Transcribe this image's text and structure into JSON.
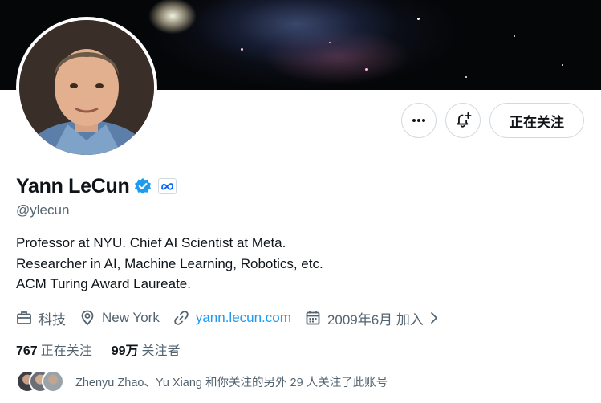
{
  "profile": {
    "name": "Yann LeCun",
    "handle": "@ylecun",
    "bio": [
      "Professor at NYU. Chief AI Scientist at Meta.",
      "Researcher in AI, Machine Learning, Robotics, etc.",
      "ACM Turing Award Laureate."
    ],
    "info": {
      "category": "科技",
      "location": "New York",
      "website": "yann.lecun.com",
      "joined": "2009年6月 加入"
    },
    "stats": {
      "following_count": "767",
      "following_label": "正在关注",
      "followers_count": "99万",
      "followers_label": "关注者"
    },
    "followers_you_know": "Zhenyu Zhao、Yu Xiang 和你关注的另外 29 人关注了此账号"
  },
  "actions": {
    "more_icon": "more-icon",
    "notify_icon": "bell-plus-icon",
    "follow_label": "正在关注"
  },
  "icons": {
    "category": "briefcase-icon",
    "location": "location-pin-icon",
    "website": "link-icon",
    "joined": "calendar-icon",
    "verified": "verified-badge-icon",
    "affiliation": "meta-logo-icon"
  },
  "colors": {
    "accent": "#1d9bf0",
    "text": "#0f1419",
    "secondary": "#536471",
    "border": "#cfd9de"
  }
}
